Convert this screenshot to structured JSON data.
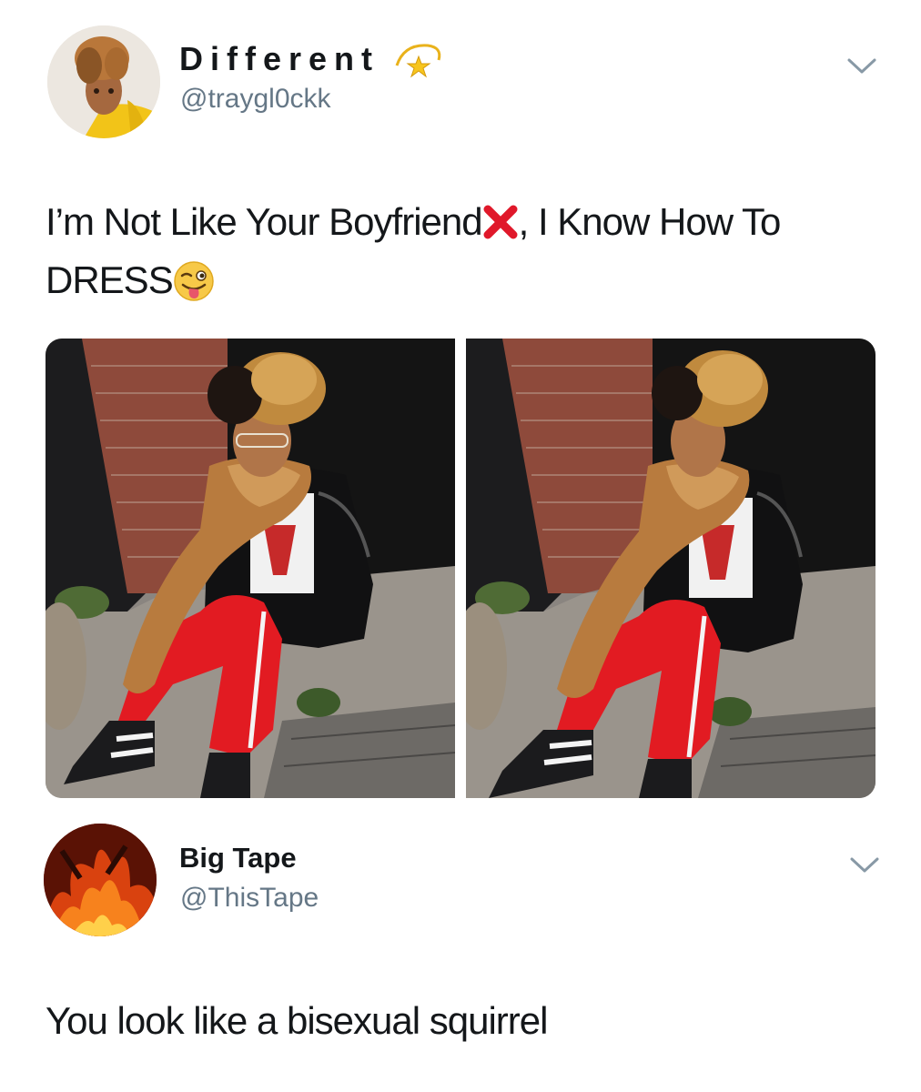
{
  "tweets": [
    {
      "display_name": "Different",
      "handle": "@traygl0ckk",
      "text_parts": [
        "I’m Not Like Your Boyfriend",
        ", I Know How To DRESS"
      ],
      "avatar_icon": "profile-photo-yellow-hoodie",
      "badge_icon": "dizzy-star-emoji",
      "menu_icon": "chevron-down-icon",
      "emojis": [
        "cross-mark-emoji",
        "winking-face-with-tongue-emoji"
      ],
      "media_count": 2
    },
    {
      "display_name": "Big Tape",
      "handle": "@ThisTape",
      "text": "You look like a bisexual squirrel",
      "avatar_icon": "fire-photo",
      "menu_icon": "chevron-down-icon"
    }
  ],
  "colors": {
    "text": "#14171a",
    "secondary_text": "#657786",
    "cross_red": "#e0182a",
    "pants_red": "#e21b22"
  }
}
